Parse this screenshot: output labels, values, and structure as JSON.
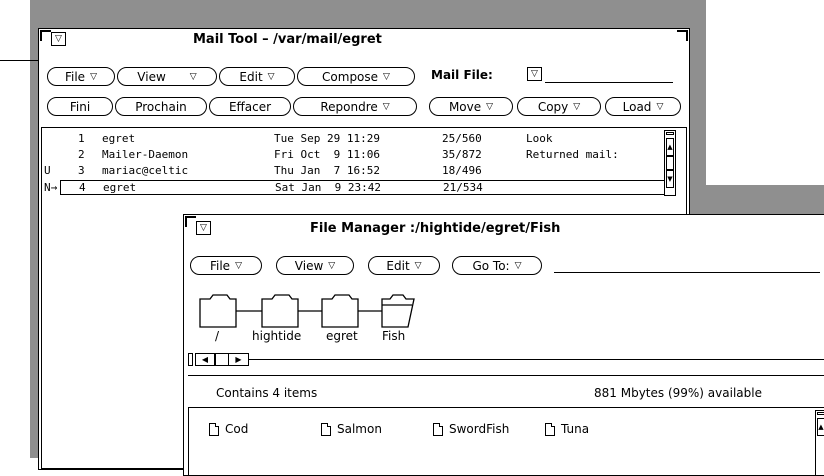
{
  "mail_tool": {
    "title": "Mail Tool – /var/mail/egret",
    "menu_glyph": "▽",
    "buttons_row1": [
      {
        "label": "File",
        "menu": true
      },
      {
        "label": "View",
        "menu": true
      },
      {
        "label": "Edit",
        "menu": true
      },
      {
        "label": "Compose",
        "menu": true
      }
    ],
    "mail_file_label": "Mail File:",
    "mail_file_value": "",
    "buttons_row2": [
      {
        "label": "Fini",
        "menu": false
      },
      {
        "label": "Prochain",
        "menu": false
      },
      {
        "label": "Effacer",
        "menu": false
      },
      {
        "label": "Repondre",
        "menu": true
      },
      {
        "label": "Move",
        "menu": true
      },
      {
        "label": "Copy",
        "menu": true
      },
      {
        "label": "Load",
        "menu": true
      }
    ],
    "messages": [
      {
        "flag": "",
        "num": "1",
        "from": "egret",
        "date": "Tue Sep 29 11:29",
        "size": "25/560",
        "subject": "Look"
      },
      {
        "flag": "",
        "num": "2",
        "from": "Mailer-Daemon",
        "date": "Fri Oct  9 11:06",
        "size": "35/872",
        "subject": "Returned mail:"
      },
      {
        "flag": "U",
        "num": "3",
        "from": "mariac@celtic",
        "date": "Thu Jan  7 16:52",
        "size": "18/496",
        "subject": ""
      },
      {
        "flag": "N→",
        "num": "4",
        "from": "egret",
        "date": "Sat Jan  9 23:42",
        "size": "21/534",
        "subject": ""
      }
    ]
  },
  "file_manager": {
    "title": "File Manager :/hightide/egret/Fish",
    "menu_glyph": "▽",
    "buttons": [
      {
        "label": "File",
        "menu": true
      },
      {
        "label": "View",
        "menu": true
      },
      {
        "label": "Edit",
        "menu": true
      },
      {
        "label": "Go To:",
        "menu": true
      }
    ],
    "goto_value": "",
    "path": [
      "/",
      "hightide",
      "egret",
      "Fish"
    ],
    "status_left": "Contains 4 items",
    "status_right": "881 Mbytes (99%) available",
    "files": [
      "Cod",
      "Salmon",
      "SwordFish",
      "Tuna"
    ]
  }
}
